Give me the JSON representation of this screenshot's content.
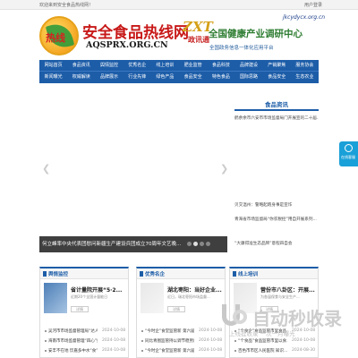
{
  "topbar": {
    "welcome": "欢迎来到安全食品热线网！",
    "user_link": "用户登录"
  },
  "header": {
    "logo_char": "热线",
    "site_name": "安全食品热线网",
    "site_domain": "AQSPRX.ORG.CN",
    "zxt_logo": "ZXT",
    "zxt_cn": "政讯通",
    "url": "jkcydycx.org.cn",
    "banner_title": "全国健康产业调研中心",
    "banner_sub": "全国政务信息一体化应用平台"
  },
  "nav": {
    "row1": [
      "网站首页",
      "食品资讯",
      "舆情监控",
      "优秀名企",
      "线上培训",
      "肥业监管",
      "食品科技",
      "品牌建设",
      "产销聚焦",
      "服务协会"
    ],
    "row2": [
      "新闻曝光",
      "权威解读",
      "品牌展示",
      "行业先锋",
      "绿色产品",
      "食品安全",
      "特色食品",
      "国际思路",
      "食品安全",
      "生态农业"
    ]
  },
  "slider": {
    "caption": "何立峰率中央代表团慰问新疆生产建设兵团成立70周年文艺晚...",
    "prev_icon": "chevron-left-icon",
    "next_icon": "chevron-right-icon",
    "dots": 4,
    "active_dot": 1
  },
  "news": {
    "title": "食品资讯",
    "items": [
      "鹤余余市六安市市场监督局门开展宣的二十届...",
      "贝交温州：警略起跑身事是宣诈",
      "青海省市场监督局“你农税控”用自开展系列...",
      "“大康得准生态品牌”意程四自会"
    ]
  },
  "service": {
    "label": "在线客服",
    "icon": "chat-icon"
  },
  "columns": [
    {
      "title": "舆情监控",
      "feature_title": "省计量院开展“5·2...",
      "feature_desc": "近期20个全国计量能日",
      "feature_btn": "详情",
      "items": [
        {
          "text": "吴河市市场监督管理局“达人...",
          "date": "2024-10-08"
        },
        {
          "text": "海南市市场监督管理“四心”推进...",
          "date": "2024-10-08"
        },
        {
          "text": "安丰不在地 饮嘉多中水“食”...",
          "date": "2024-10-08"
        }
      ]
    },
    {
      "title": "优秀名企",
      "feature_title": "湖北枣阳：当好企业...",
      "feature_desc": "近日，瑞北枣阳市场监督...",
      "feature_btn": "详情",
      "items": [
        {
          "text": "“今时企”食堂监管新 第六届公...",
          "date": "2024-10-08"
        },
        {
          "text": "同比青图监管持以调节稳势向...",
          "date": "2024-10-08"
        },
        {
          "text": "“今时企”食堂监管新 第六届公...",
          "date": "2024-10-08"
        }
      ]
    },
    {
      "title": "线上培训",
      "feature_title": "营份市八卦区：开展...",
      "feature_desc": "为各届保食与安全生产...",
      "feature_btn": "详情",
      "items": [
        {
          "text": "“个食企”食品监管市里食品...",
          "date": "2024-10-08"
        },
        {
          "text": "“个食品”食品监管市里以食...",
          "date": "2024-10-08"
        },
        {
          "text": "百色市市区人民医院 知识...",
          "date": "2024-08-30"
        }
      ]
    }
  ],
  "watermark": {
    "text": "自动秒收录",
    "sub": "上线提收录 一次一月曝光"
  }
}
